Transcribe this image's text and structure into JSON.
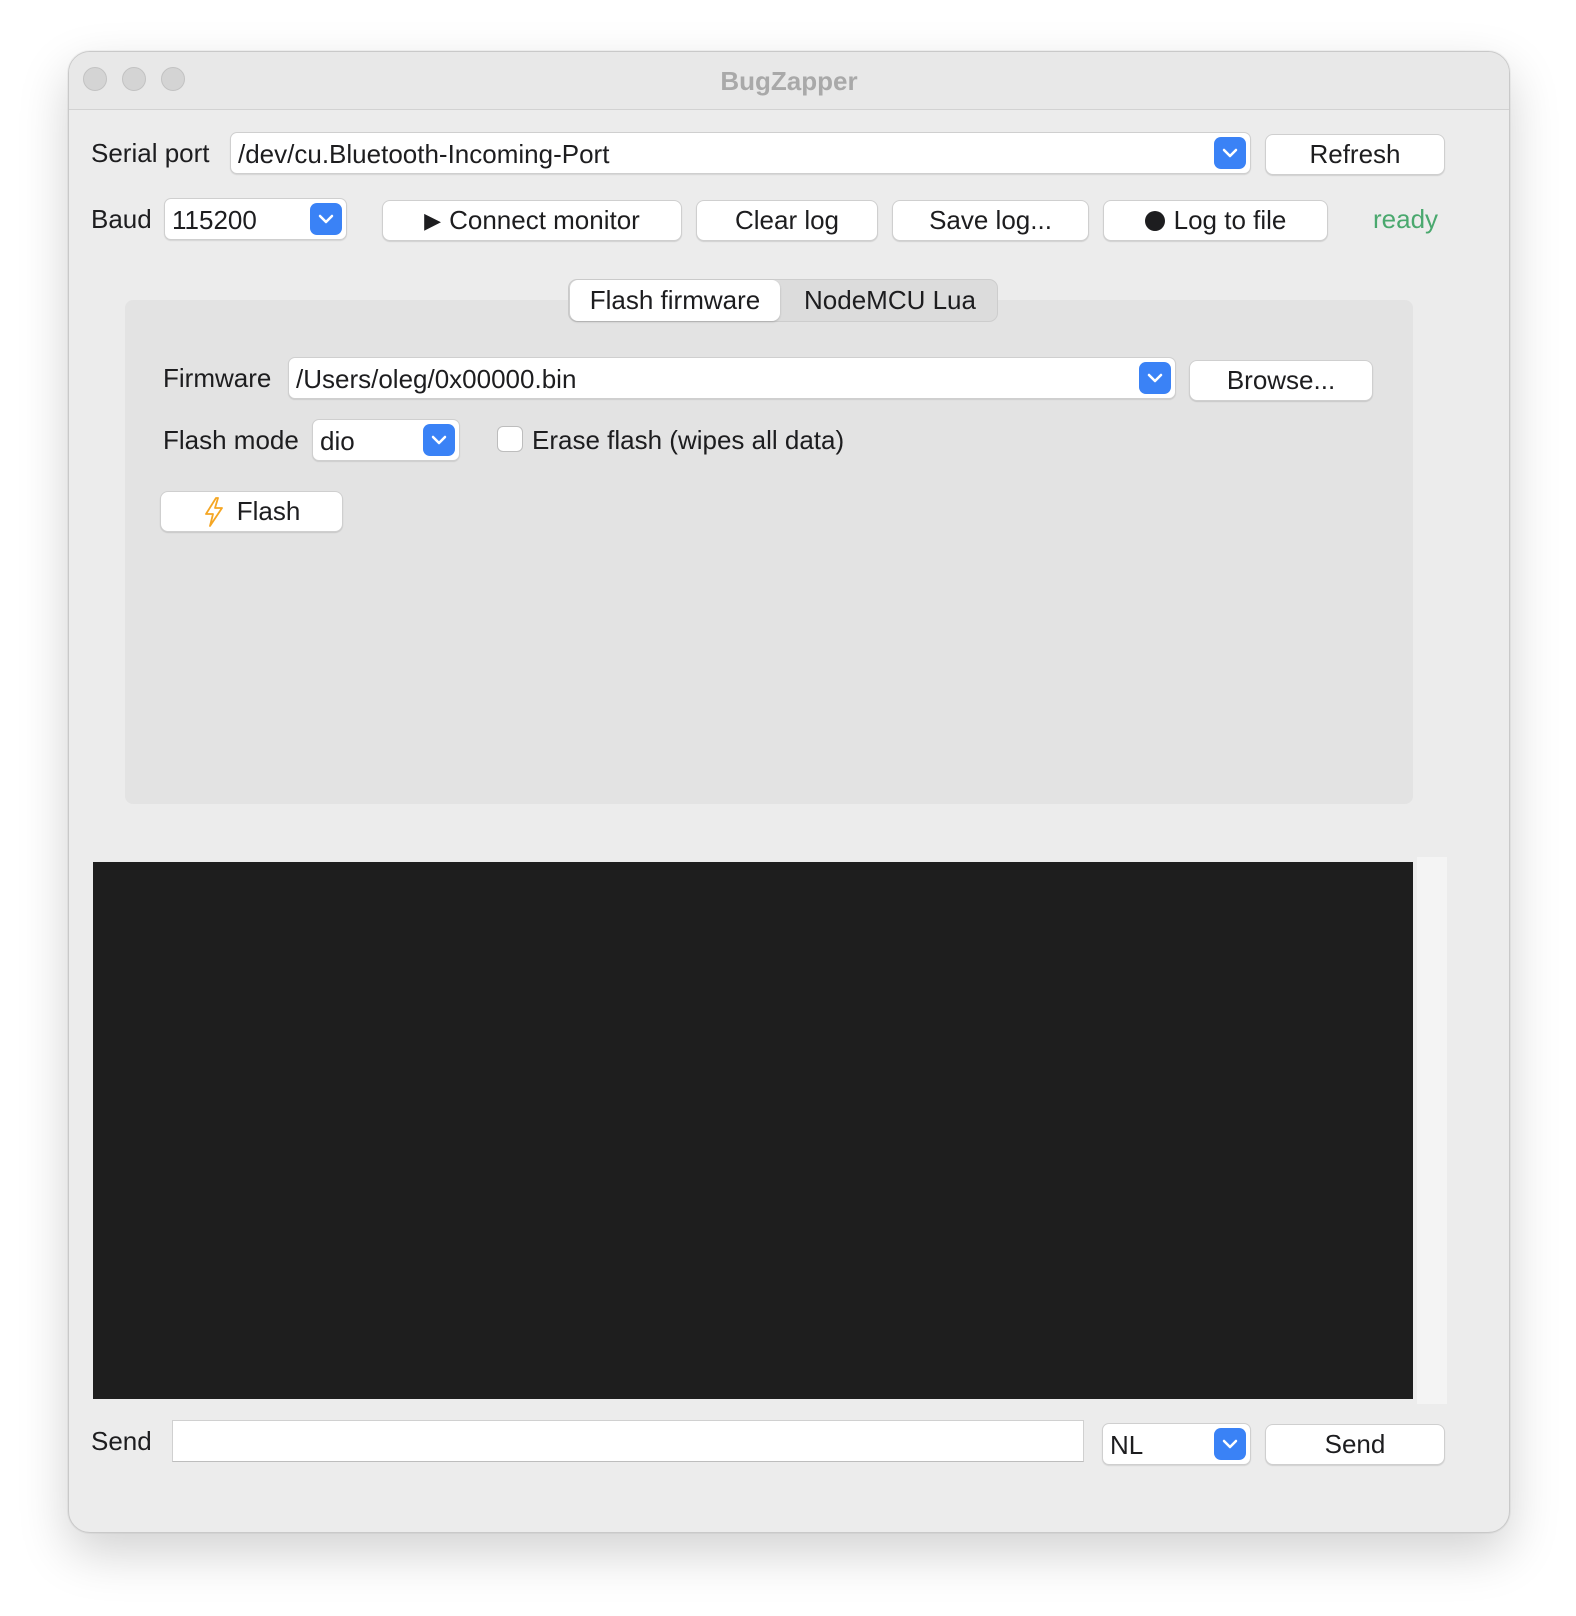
{
  "window": {
    "title": "BugZapper"
  },
  "serial": {
    "label": "Serial port",
    "port_value": "/dev/cu.Bluetooth-Incoming-Port",
    "refresh_label": "Refresh"
  },
  "baud": {
    "label": "Baud",
    "value": "115200"
  },
  "toolbar": {
    "connect_label": "Connect monitor",
    "connect_icon": "play-icon",
    "clear_label": "Clear log",
    "save_label": "Save log...",
    "logfile_label": "Log to file",
    "logfile_icon": "record-icon",
    "status": "ready",
    "status_color": "#4aa86e"
  },
  "tabs": [
    {
      "label": "Flash firmware",
      "selected": true
    },
    {
      "label": "NodeMCU Lua",
      "selected": false
    }
  ],
  "flash": {
    "firmware_label": "Firmware",
    "firmware_value": "/Users/oleg/0x00000.bin",
    "browse_label": "Browse...",
    "mode_label": "Flash mode",
    "mode_value": "dio",
    "erase_label": "Erase flash (wipes all data)",
    "erase_checked": false,
    "flash_button_label": "Flash",
    "flash_icon": "lightning-icon"
  },
  "console": {
    "lines": []
  },
  "send": {
    "label": "Send",
    "input_value": "",
    "line_ending": "NL",
    "send_label": "Send"
  },
  "colors": {
    "accent": "#3a82f6",
    "console_bg": "#1e1e1e"
  }
}
